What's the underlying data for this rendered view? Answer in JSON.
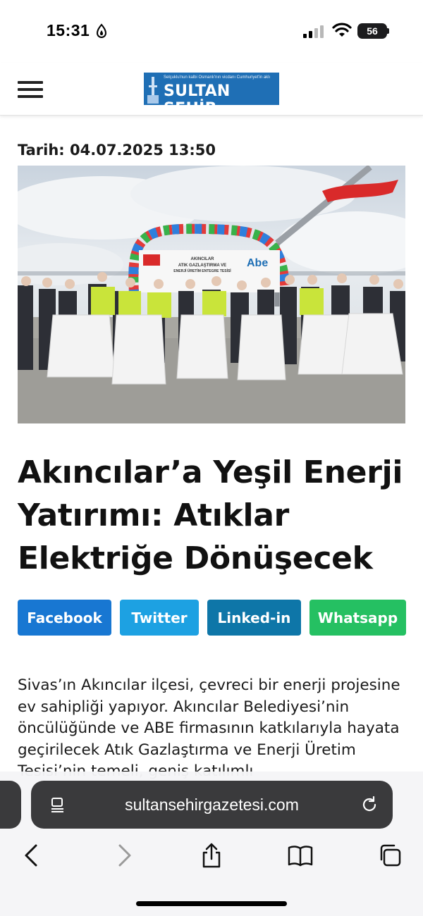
{
  "status_bar": {
    "time": "15:31",
    "battery": "56",
    "location_icon": "location-arrow-icon",
    "signal_icon": "cellular-signal-icon",
    "wifi_icon": "wifi-icon"
  },
  "site": {
    "logo_tagline": "Selçuklu'nun kalbi Osmanlı'nın vicdanı Cumhuriyet'in aklı",
    "logo_name": "SULTAN ŞEHİR",
    "menu_icon": "hamburger-menu-icon"
  },
  "article": {
    "date": "Tarih: 04.07.2025 13:50",
    "title": "Akıncılar’a Yeşil Enerji Yatırımı: Atıklar Elektriğe Dönüşecek",
    "body": "Sivas’ın Akıncılar ilçesi, çevreci bir enerji projesine ev sahipliği yapıyor. Akıncılar Belediyesi’nin öncülüğünde ve ABE firmasının katkılarıyla hayata geçirilecek Atık Gazlaştırma ve Enerji Üretim Tesisi’nin temeli, geniş katılımlı",
    "photo_banner_line1": "AKINCILAR",
    "photo_banner_line2": "ATIK GAZLAŞTIRMA VE",
    "photo_banner_line3": "ENERJİ ÜRETİM ENTEGRE TESİSİ",
    "photo_banner_brand": "Abe"
  },
  "share": {
    "facebook": "Facebook",
    "twitter": "Twitter",
    "linkedin": "Linked-in",
    "whatsapp": "Whatsapp"
  },
  "colors": {
    "facebook": "#1877d2",
    "twitter": "#1da1e2",
    "linkedin": "#0e76a8",
    "whatsapp": "#25c062",
    "logo_blue": "#1f6fb5"
  },
  "browser": {
    "url": "sultansehirgazetesi.com",
    "reader_icon": "reader-mode-icon",
    "reload_icon": "reload-icon",
    "toolbar": [
      "back-arrow-icon",
      "forward-arrow-icon",
      "share-icon",
      "bookmarks-book-icon",
      "tabs-icon"
    ]
  }
}
